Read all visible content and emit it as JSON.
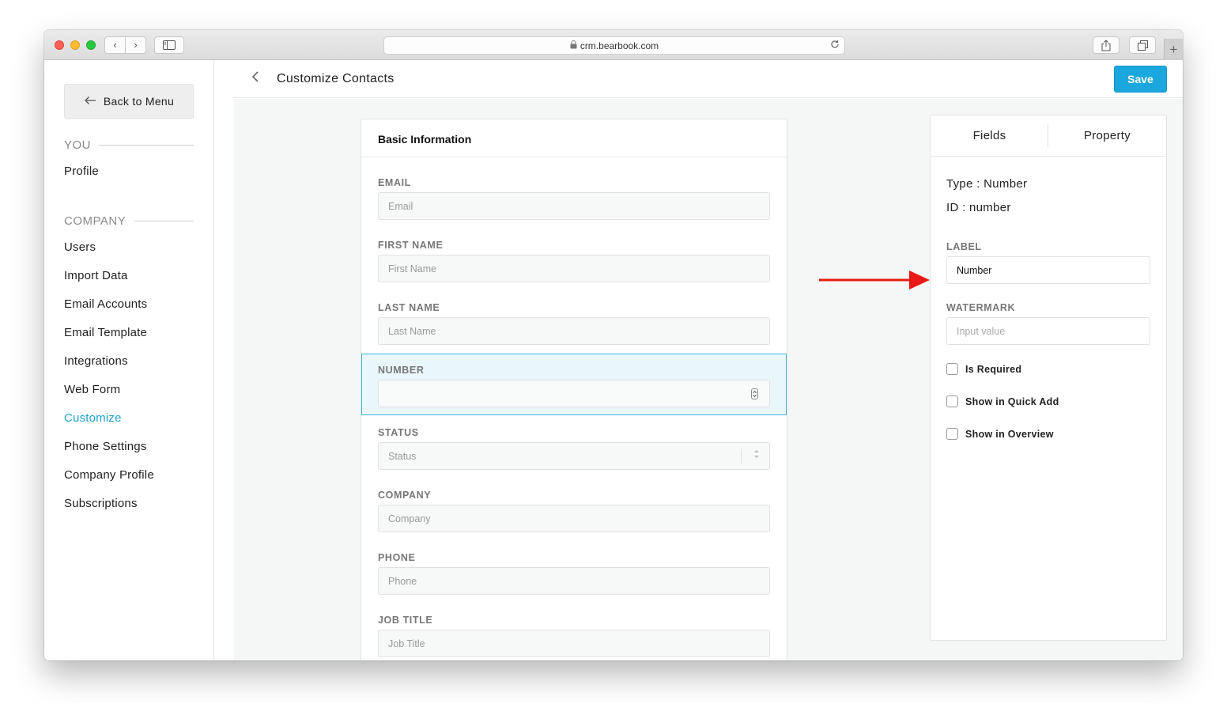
{
  "browser": {
    "url": "crm.bearbook.com",
    "back_glyph": "‹",
    "forward_glyph": "›",
    "new_tab_glyph": "+"
  },
  "left_nav": {
    "back_label": "Back to Menu",
    "you_heading": "YOU",
    "you_items": [
      "Profile"
    ],
    "company_heading": "COMPANY",
    "company_items": [
      "Users",
      "Import Data",
      "Email Accounts",
      "Email Template",
      "Integrations",
      "Web Form",
      "Customize",
      "Phone Settings",
      "Company Profile",
      "Subscriptions"
    ],
    "active_item": "Customize",
    "active_color": "#1ea2cd"
  },
  "header": {
    "title": "Customize Contacts",
    "save_label": "Save",
    "save_color": "#1ba7dd"
  },
  "form": {
    "section_title": "Basic Information",
    "fields": [
      {
        "label": "EMAIL",
        "placeholder": "Email",
        "type": "text"
      },
      {
        "label": "FIRST NAME",
        "placeholder": "First Name",
        "type": "text"
      },
      {
        "label": "LAST NAME",
        "placeholder": "Last Name",
        "type": "text"
      },
      {
        "label": "NUMBER",
        "placeholder": "",
        "type": "number",
        "selected": true
      },
      {
        "label": "STATUS",
        "placeholder": "Status",
        "type": "select"
      },
      {
        "label": "COMPANY",
        "placeholder": "Company",
        "type": "text"
      },
      {
        "label": "PHONE",
        "placeholder": "Phone",
        "type": "text"
      },
      {
        "label": "JOB TITLE",
        "placeholder": "Job Title",
        "type": "text"
      }
    ]
  },
  "annotation": {
    "arrow_color": "#e81a16",
    "icon": "right-arrow-icon"
  },
  "properties": {
    "tabs": [
      "Fields",
      "Property"
    ],
    "type_line": "Type : Number",
    "id_line": "ID : number",
    "label_heading": "LABEL",
    "label_value": "Number",
    "watermark_heading": "WATERMARK",
    "watermark_placeholder": "Input value",
    "checkboxes": [
      {
        "label": "Is Required",
        "checked": false
      },
      {
        "label": "Show in Quick Add",
        "checked": false
      },
      {
        "label": "Show in Overview",
        "checked": false
      }
    ]
  }
}
